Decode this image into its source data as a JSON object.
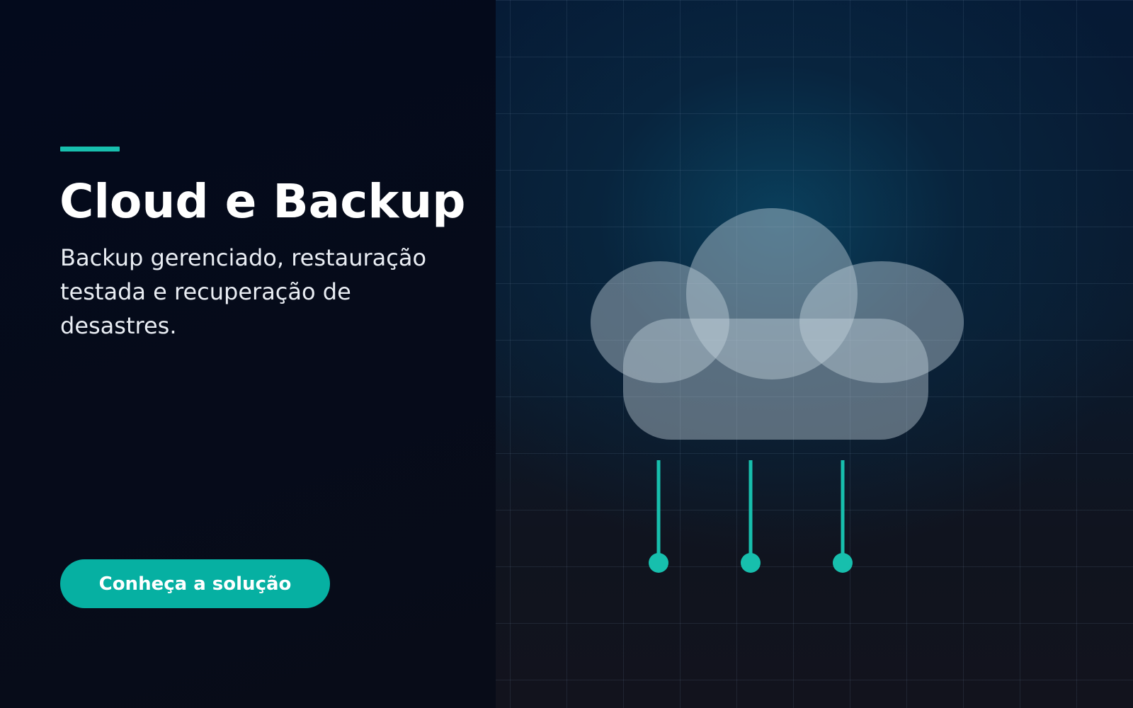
{
  "hero": {
    "title": "Cloud e Backup",
    "subtitle": "Backup gerenciado, restauração testada e recuperação de desastres.",
    "cta_label": "Conheça a solução"
  },
  "colors": {
    "accent": "#18bfae",
    "button": "#06b0a2",
    "background": "#050b1d"
  },
  "illustration": {
    "icon": "cloud-backup-icon",
    "connectors": 3
  }
}
